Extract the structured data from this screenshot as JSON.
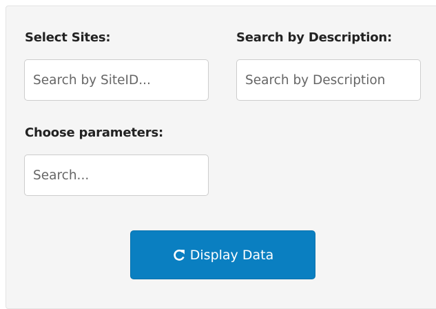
{
  "filters": {
    "sites": {
      "label": "Select Sites:",
      "placeholder": "Search by SiteID..."
    },
    "description": {
      "label": "Search by Description:",
      "placeholder": "Search by Description"
    },
    "parameters": {
      "label": "Choose parameters:",
      "placeholder": "Search..."
    }
  },
  "actions": {
    "display_button": {
      "label": "Display Data",
      "icon": "refresh-icon",
      "color": "#0a7fc1"
    }
  },
  "colors": {
    "panel_background": "#f5f5f5",
    "label_text": "#222222"
  }
}
